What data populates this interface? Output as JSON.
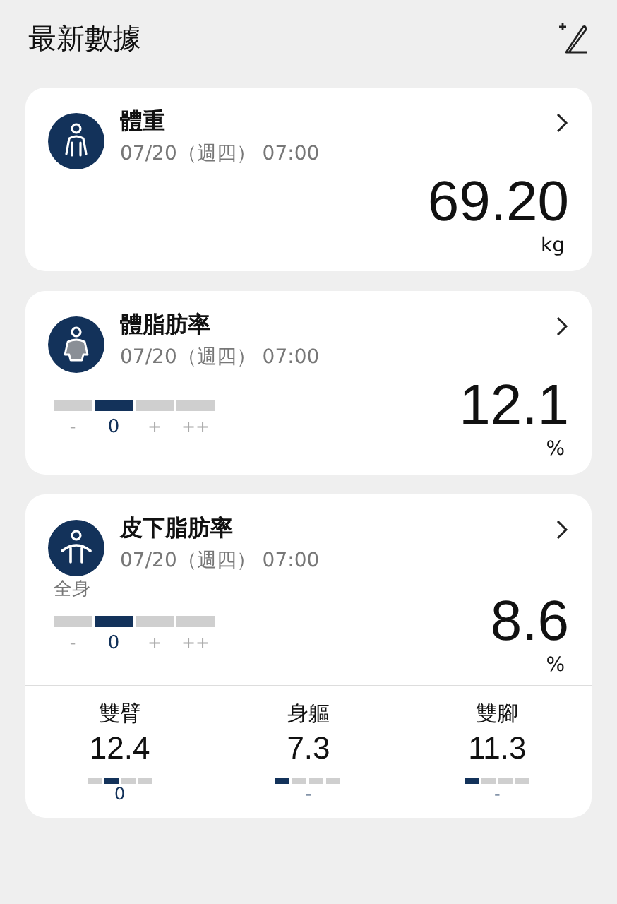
{
  "header": {
    "title": "最新數據"
  },
  "cards": [
    {
      "kind": "weight",
      "title": "體重",
      "date": "07/20（週四） 07:00",
      "value": "69.20",
      "unit": "kg"
    },
    {
      "kind": "body-fat",
      "title": "體脂肪率",
      "date": "07/20（週四） 07:00",
      "value": "12.1",
      "unit": "%",
      "scale": [
        {
          "label": "-",
          "selected": false
        },
        {
          "label": "0",
          "selected": true
        },
        {
          "label": "+",
          "selected": false
        },
        {
          "label": "++",
          "selected": false
        }
      ]
    },
    {
      "kind": "subcutaneous",
      "title": "皮下脂肪率",
      "date": "07/20（週四） 07:00",
      "scale_label": "全身",
      "value": "8.6",
      "unit": "%",
      "scale": [
        {
          "label": "-",
          "selected": false
        },
        {
          "label": "0",
          "selected": true
        },
        {
          "label": "+",
          "selected": false
        },
        {
          "label": "++",
          "selected": false
        }
      ],
      "parts": [
        {
          "label": "雙臂",
          "value": "12.4",
          "reading": "0",
          "scale": [
            {
              "selected": false
            },
            {
              "selected": true
            },
            {
              "selected": false
            },
            {
              "selected": false
            }
          ]
        },
        {
          "label": "身軀",
          "value": "7.3",
          "reading": "-",
          "scale": [
            {
              "selected": true
            },
            {
              "selected": false
            },
            {
              "selected": false
            },
            {
              "selected": false
            }
          ]
        },
        {
          "label": "雙腳",
          "value": "11.3",
          "reading": "-",
          "scale": [
            {
              "selected": true
            },
            {
              "selected": false
            },
            {
              "selected": false
            },
            {
              "selected": false
            }
          ]
        }
      ]
    }
  ]
}
